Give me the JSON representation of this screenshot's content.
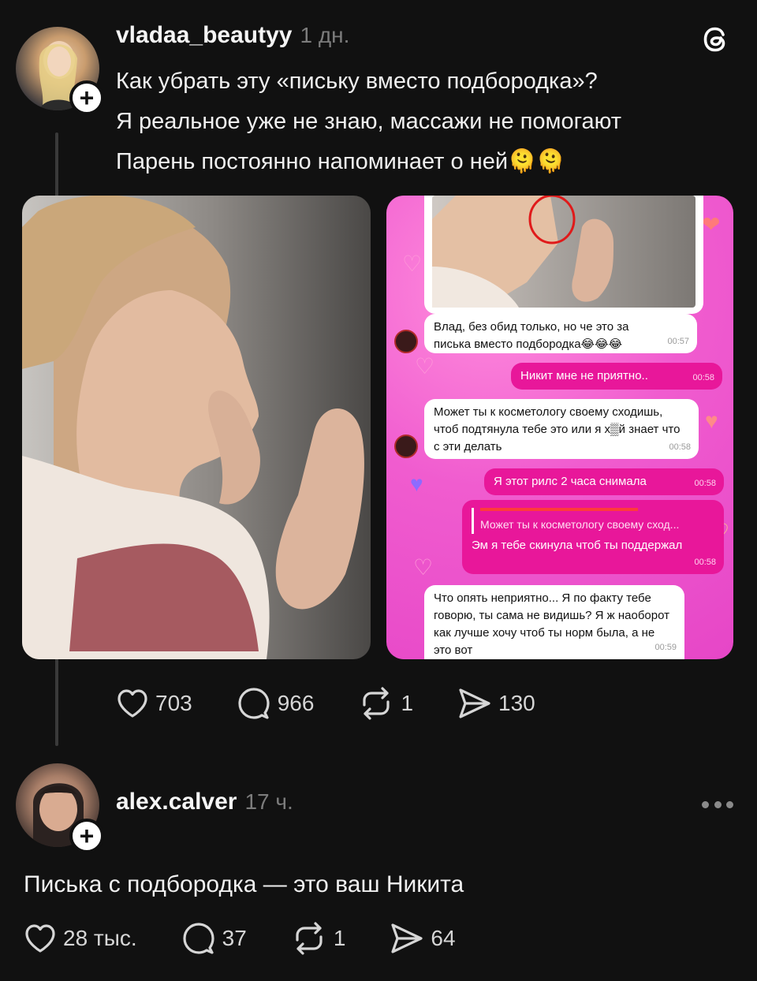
{
  "post": {
    "username": "vladaa_beautyy",
    "time": "1 дн.",
    "lines": [
      "Как убрать эту «письку вместо подбородка»?",
      "Я реальное уже не знаю, массажи не помогают",
      "Парень постоянно напоминает о ней🫠🫠"
    ],
    "likes": "703",
    "comments": "966",
    "reposts": "1",
    "shares": "130"
  },
  "chat": {
    "messages": [
      {
        "dir": "in",
        "text": "Влад, без обид только, но че это за писька вместо подбородка😂😂😂",
        "time": "00:57"
      },
      {
        "dir": "out",
        "text": "Никит мне не приятно..",
        "time": "00:58"
      },
      {
        "dir": "in",
        "text": "Может ты к косметологу своему сходишь, чтоб подтянула тебе это или я х▒й знает что с эти делать",
        "time": "00:58"
      },
      {
        "dir": "out",
        "text": "Я этот рилс 2 часа снимала",
        "time": "00:58"
      },
      {
        "dir": "out",
        "quote": "Может ты к косметологу своему сход...",
        "text": "Эм я тебе скинула чтоб ты поддержал",
        "time": "00:58"
      },
      {
        "dir": "in",
        "text": "Что опять неприятно... Я по факту тебе говорю, ты сама не видишь? Я ж наоборот как лучше хочу чтоб ты норм была, а не это вот",
        "time": "00:59"
      }
    ]
  },
  "reply": {
    "username": "alex.calver",
    "time": "17 ч.",
    "text": "Писька с подбородка — это ваш Никита",
    "likes": "28 тыс.",
    "comments": "37",
    "reposts": "1",
    "shares": "64",
    "more_icon": "more-dots-icon"
  },
  "icons": {
    "app": "threads-logo-icon",
    "like": "heart-icon",
    "comment": "comment-bubble-icon",
    "repost": "repost-icon",
    "share": "send-icon",
    "follow": "plus-icon"
  },
  "colors": {
    "background": "#111111",
    "text": "#f3f3f3",
    "muted": "#7c7c7c",
    "chat_out": "#e8179a",
    "chat_bg": "#f05ccf"
  }
}
